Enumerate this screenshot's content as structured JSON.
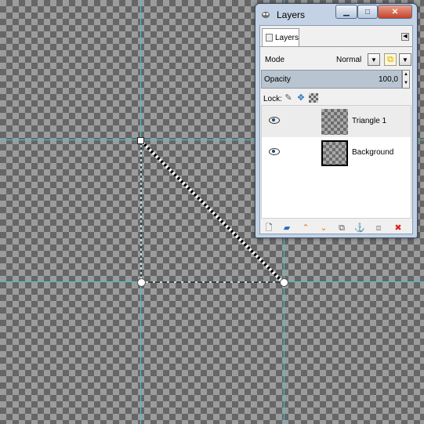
{
  "dialog": {
    "title": "Layers",
    "tab_label": "Layers",
    "mode_label": "Mode",
    "mode_value": "Normal",
    "opacity_label": "Opacity",
    "opacity_value": "100,0",
    "lock_label": "Lock:",
    "layers": [
      {
        "name": "Triangle 1",
        "selected": true
      },
      {
        "name": "Background",
        "selected": false
      }
    ]
  },
  "colors": {
    "guide": "#3cc8cf",
    "dialog_frame": "#c3d2e4",
    "close_button": "#c7412a"
  },
  "icons": {
    "toolbar": [
      "new-layer-icon",
      "new-group-icon",
      "raise-layer-icon",
      "lower-layer-icon",
      "duplicate-layer-icon",
      "anchor-layer-icon",
      "merge-down-icon",
      "delete-layer-icon"
    ]
  }
}
